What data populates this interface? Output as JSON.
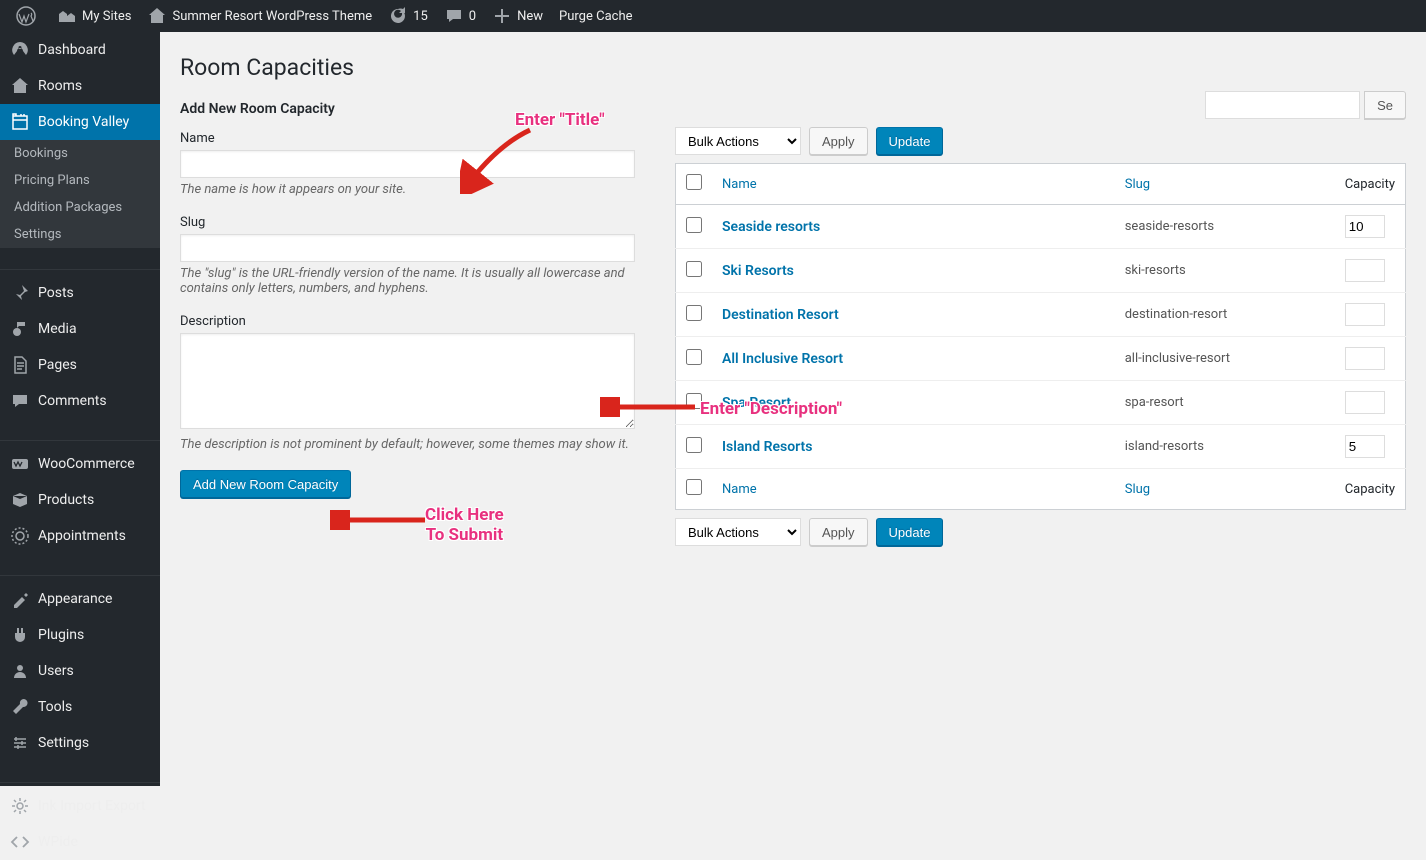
{
  "adminbar": {
    "mysites": "My Sites",
    "sitename": "Summer Resort WordPress Theme",
    "updates": "15",
    "comments": "0",
    "new": "New",
    "purge": "Purge Cache"
  },
  "sidebar": {
    "items": [
      {
        "label": "Dashboard"
      },
      {
        "label": "Rooms"
      },
      {
        "label": "Booking Valley"
      },
      {
        "label": "Posts"
      },
      {
        "label": "Media"
      },
      {
        "label": "Pages"
      },
      {
        "label": "Comments"
      },
      {
        "label": "WooCommerce"
      },
      {
        "label": "Products"
      },
      {
        "label": "Appointments"
      },
      {
        "label": "Appearance"
      },
      {
        "label": "Plugins"
      },
      {
        "label": "Users"
      },
      {
        "label": "Tools"
      },
      {
        "label": "Settings"
      },
      {
        "label": "Ink Import Export"
      },
      {
        "label": "WPide"
      }
    ],
    "submenu": [
      {
        "label": "Bookings"
      },
      {
        "label": "Pricing Plans"
      },
      {
        "label": "Addition Packages"
      },
      {
        "label": "Settings"
      }
    ]
  },
  "page": {
    "title": "Room Capacities",
    "add_title": "Add New Room Capacity",
    "name_label": "Name",
    "name_hint": "The name is how it appears on your site.",
    "slug_label": "Slug",
    "slug_hint": "The \"slug\" is the URL-friendly version of the name. It is usually all lowercase and contains only letters, numbers, and hyphens.",
    "desc_label": "Description",
    "desc_hint": "The description is not prominent by default; however, some themes may show it.",
    "submit": "Add New Room Capacity"
  },
  "tablenav": {
    "bulk": "Bulk Actions",
    "apply": "Apply",
    "update": "Update",
    "search_btn": "Se"
  },
  "table": {
    "col_name": "Name",
    "col_slug": "Slug",
    "col_capacity": "Capacity",
    "rows": [
      {
        "name": "Seaside resorts",
        "slug": "seaside-resorts",
        "cap": "10"
      },
      {
        "name": "Ski Resorts",
        "slug": "ski-resorts",
        "cap": ""
      },
      {
        "name": "Destination Resort",
        "slug": "destination-resort",
        "cap": ""
      },
      {
        "name": "All Inclusive Resort",
        "slug": "all-inclusive-resort",
        "cap": ""
      },
      {
        "name": "Spa Resort",
        "slug": "spa-resort",
        "cap": ""
      },
      {
        "name": "Island Resorts",
        "slug": "island-resorts",
        "cap": "5"
      }
    ]
  },
  "annotations": {
    "a1": "Enter \"Title\"",
    "a2": "Enter \"Description\"",
    "a3_l1": "Click Here",
    "a3_l2": "To Submit"
  }
}
